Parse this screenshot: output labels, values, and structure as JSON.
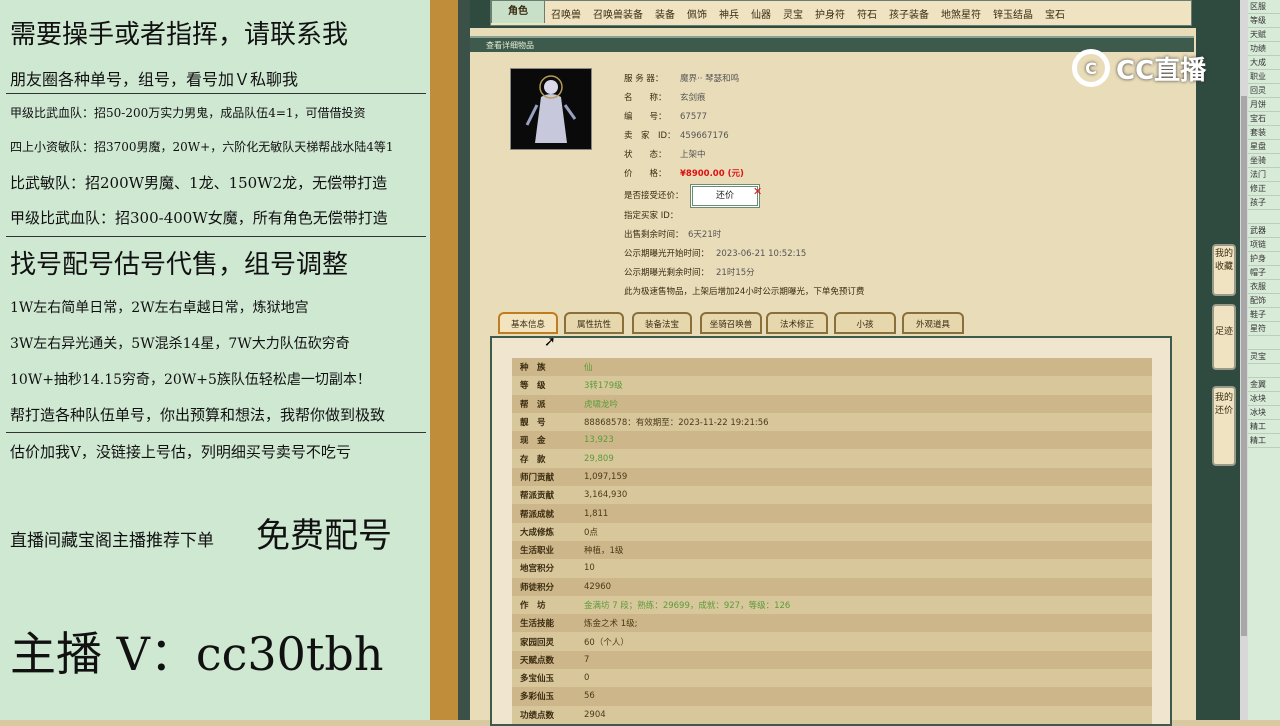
{
  "left_panel": {
    "lines": [
      "需要操手或者指挥，请联系我",
      "朋友圈各种单号，组号，看号加Ｖ私聊我",
      "甲级比武血队：招50-200万实力男鬼，成品队伍4=1，可借借投资",
      "四上小资敏队：招3700男魔，20W+，六阶化无敏队天梯帮战水陆4等1",
      "比武敏队：招200W男魔、1龙、150W2龙，无偿带打造",
      "甲级比武血队：招300-400W女魔，所有角色无偿带打造",
      "找号配号估号代售，组号调整",
      "1W左右简单日常，2W左右卓越日常，炼狱地宫",
      "3W左右异光通关，5W混杀14星，7W大力队伍砍穷奇",
      "10W+抽秒14.15穷奇，20W+5族队伍轻松虐一切副本！",
      "帮打造各种队伍单号，你出预算和想法，我帮你做到极致",
      "估价加我V，没链接上号估，列明细买号卖号不吃亏",
      "直播间藏宝阁主播推荐下单",
      "免费配号",
      "主播 V：cc30tbh"
    ]
  },
  "top_nav": {
    "tabs": [
      "角色",
      "召唤兽",
      "召唤兽装备",
      "装备",
      "佩饰",
      "神兵",
      "仙器",
      "灵宝",
      "护身符",
      "符石",
      "孩子装备",
      "地煞星符",
      "锌玉结晶",
      "宝石"
    ]
  },
  "header": {
    "title": "查看详细物品"
  },
  "info": {
    "server_label": "服 务 器：",
    "server": "魔界·· 琴瑟和鸣",
    "name_label": "名　　称：",
    "name": "玄剑痕",
    "id_label": "编　　号：",
    "id": "67577",
    "seller_label": "卖　家　ID：",
    "seller": "459667176",
    "status_label": "状　　态：",
    "status": "上架中",
    "price_label": "价　　格：",
    "price": "¥8900.00 (元)",
    "counter_label": "是否接受还价：",
    "counter_button": "还价",
    "buyer_label": "指定买家 ID：",
    "buyer": "",
    "remain_label": "出售剩余时间：",
    "remain": "6天21时",
    "pub_start_label": "公示期曝光开始时间：",
    "pub_start": "2023-06-21 10:52:15",
    "pub_remain_label": "公示期曝光剩余时间：",
    "pub_remain": "21时15分",
    "note": "此为极速售物品，上架后增加24小时公示期曝光，下单免预订费"
  },
  "sub_tabs": [
    "基本信息",
    "属性抗性",
    "装备法宝",
    "坐骑召唤兽",
    "法术修正",
    "小孩",
    "外观道具"
  ],
  "rows": [
    {
      "label": "种　族",
      "value": "仙"
    },
    {
      "label": "等　级",
      "value": "3转179级"
    },
    {
      "label": "帮　派",
      "value": "虎啸龙吟"
    },
    {
      "label": "靓　号",
      "value": "88868578：有效期至：2023-11-22 19:21:56"
    },
    {
      "label": "现　金",
      "value": "13,923"
    },
    {
      "label": "存　款",
      "value": "29,809"
    },
    {
      "label": "师门贡献",
      "value": "1,097,159"
    },
    {
      "label": "帮派贡献",
      "value": "3,164,930"
    },
    {
      "label": "帮派成就",
      "value": "1,811"
    },
    {
      "label": "大成修炼",
      "value": "0点"
    },
    {
      "label": "生活职业",
      "value": "种植，1级"
    },
    {
      "label": "地宫积分",
      "value": "10"
    },
    {
      "label": "师徒积分",
      "value": "42960"
    },
    {
      "label": "作　坊",
      "value": "金满坊 7 段；熟练：29699，成就：927，等级：126"
    },
    {
      "label": "生活技能",
      "value": "炼金之术 1级;"
    },
    {
      "label": "家园回灵",
      "value": "60（个人）"
    },
    {
      "label": "天赋点数",
      "value": "7"
    },
    {
      "label": "多宝仙玉",
      "value": "0"
    },
    {
      "label": "多彩仙玉",
      "value": "56"
    },
    {
      "label": "功绩点数",
      "value": "2904"
    }
  ],
  "side_buttons": [
    "我的收藏",
    "足迹",
    "我的还价"
  ],
  "logo": {
    "text": "CC直播"
  },
  "right_col": [
    "区服",
    "等级",
    "天赋",
    "功绩",
    "大成",
    "职业",
    "回灵",
    "月饼",
    "宝石",
    "套装",
    "星盘",
    "坐骑",
    "法门",
    "修正",
    "孩子",
    "",
    "武器",
    "项链",
    "护身",
    "帽子",
    "衣服",
    "配饰",
    "鞋子",
    "星符",
    "",
    "灵宝",
    "",
    "金翼",
    "冰块",
    "冰块",
    "精工",
    "精工"
  ]
}
